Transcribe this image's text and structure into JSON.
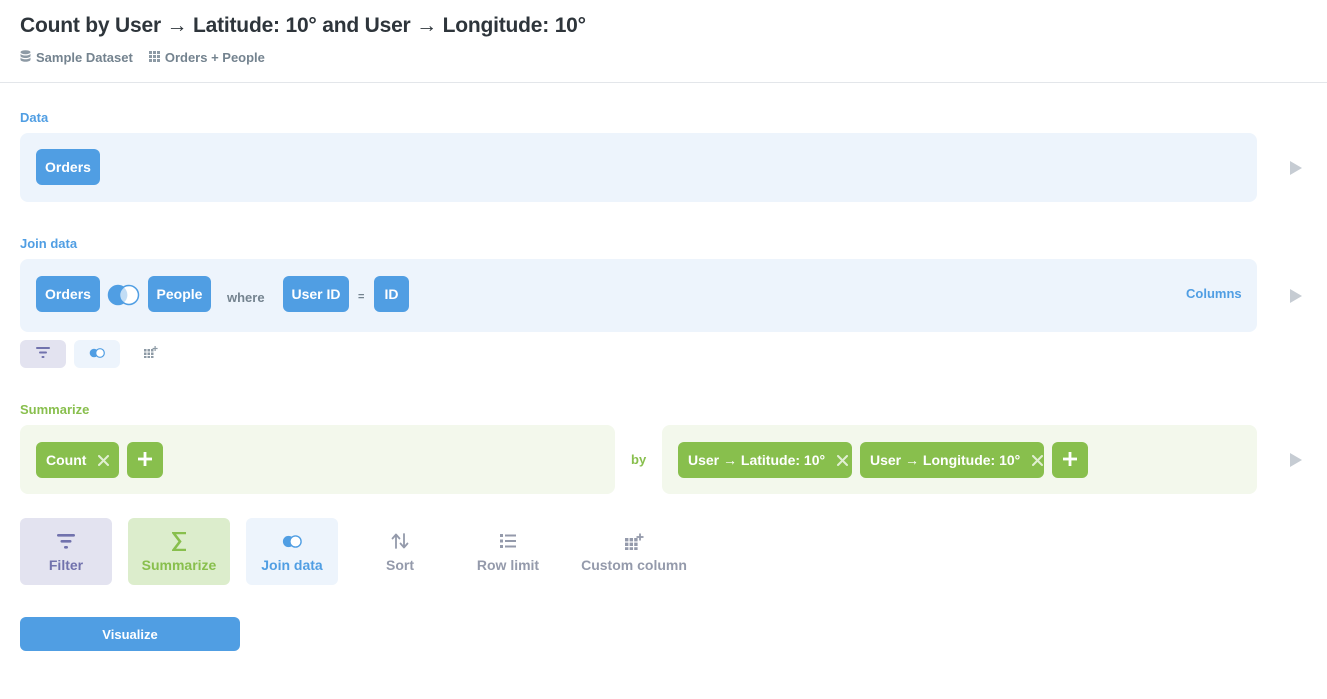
{
  "header": {
    "title": "Count by User → Latitude: 10° and User → Longitude: 10°",
    "database": "Sample Dataset",
    "table": "Orders + People"
  },
  "data_step": {
    "label": "Data",
    "source": "Orders"
  },
  "join_step": {
    "label": "Join data",
    "left_table": "Orders",
    "right_table": "People",
    "where_text": "where",
    "left_column": "User ID",
    "operator": "=",
    "right_column": "ID",
    "columns_link": "Columns",
    "join_type_icon": "left-join-icon"
  },
  "summarize_step": {
    "label": "Summarize",
    "metric": "Count",
    "by_text": "by",
    "breakouts": [
      "User → Latitude: 10°",
      "User → Longitude: 10°"
    ]
  },
  "actions": {
    "filter": "Filter",
    "summarize": "Summarize",
    "join": "Join data",
    "sort": "Sort",
    "row_limit": "Row limit",
    "custom_column": "Custom column"
  },
  "visualize_button": "Visualize",
  "colors": {
    "brand": "#509ee3",
    "summarize": "#88bf4d",
    "filter": "#7172ad"
  }
}
